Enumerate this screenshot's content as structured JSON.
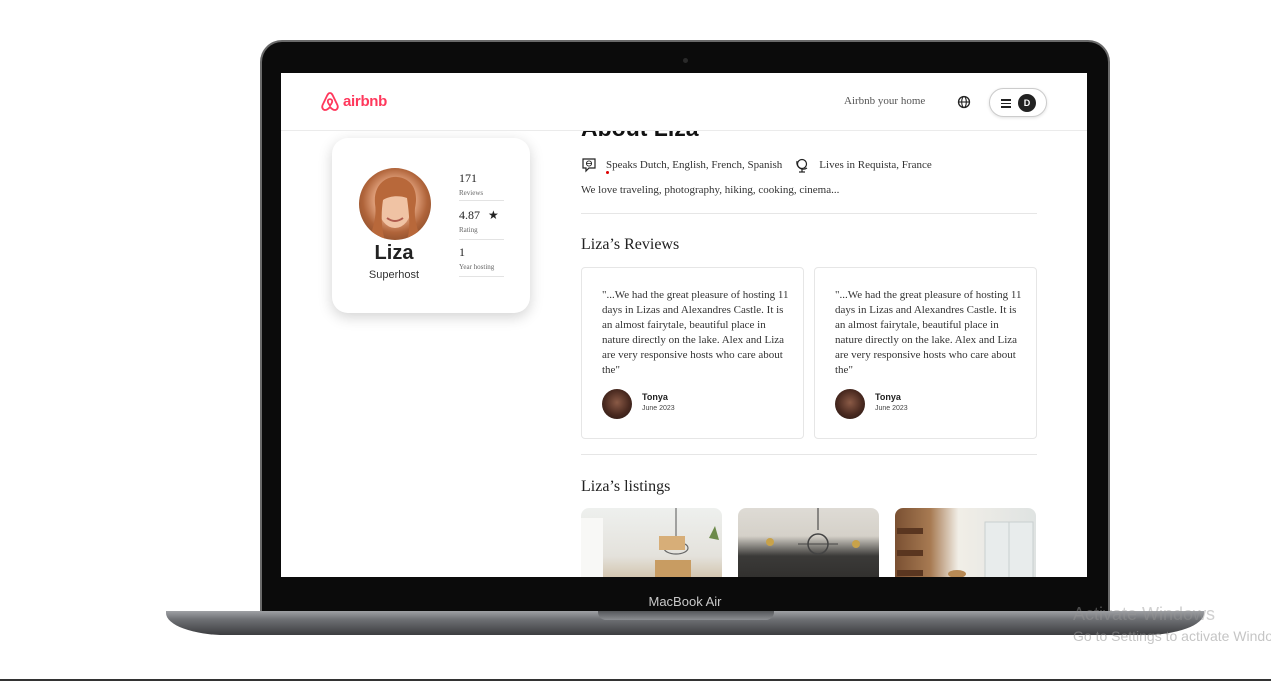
{
  "nav": {
    "logo_text": "airbnb",
    "host_link": "Airbnb your home",
    "avatar_initial": "D"
  },
  "profile": {
    "name": "Liza",
    "role": "Superhost",
    "stats": [
      {
        "value": "171",
        "label": "Reviews"
      },
      {
        "value": "4.87",
        "label": "Rating"
      },
      {
        "value": "1",
        "label": "Year hosting"
      }
    ]
  },
  "about": {
    "title": "About Liza",
    "languages": "Speaks Dutch, English, French, Spanish",
    "location": "Lives in Requista, France",
    "bio": "We love traveling, photography, hiking, cooking, cinema..."
  },
  "reviews": {
    "title": "Liza’s Reviews",
    "items": [
      {
        "text": "\"...We had the great pleasure of hosting 11 days in Lizas and Alexandres Castle. It is an almost fairytale, beautiful place in nature directly on the lake. Alex and Liza are very responsive hosts who care about the\"",
        "author": "Tonya",
        "date": "June 2023"
      },
      {
        "text": "\"...We had the great pleasure of hosting 11 days in Lizas and Alexandres Castle. It is an almost fairytale, beautiful place in nature directly on the lake. Alex and Liza are very responsive hosts who care about the\"",
        "author": "Tonya",
        "date": "June 2023"
      }
    ]
  },
  "listings": {
    "title": "Liza’s listings"
  },
  "device": {
    "label": "MacBook Air"
  },
  "watermark": {
    "title": "Activate Windows",
    "subtitle": "Go to Settings to activate Windows."
  },
  "colors": {
    "brand": "#ff385c",
    "text": "#222222"
  }
}
